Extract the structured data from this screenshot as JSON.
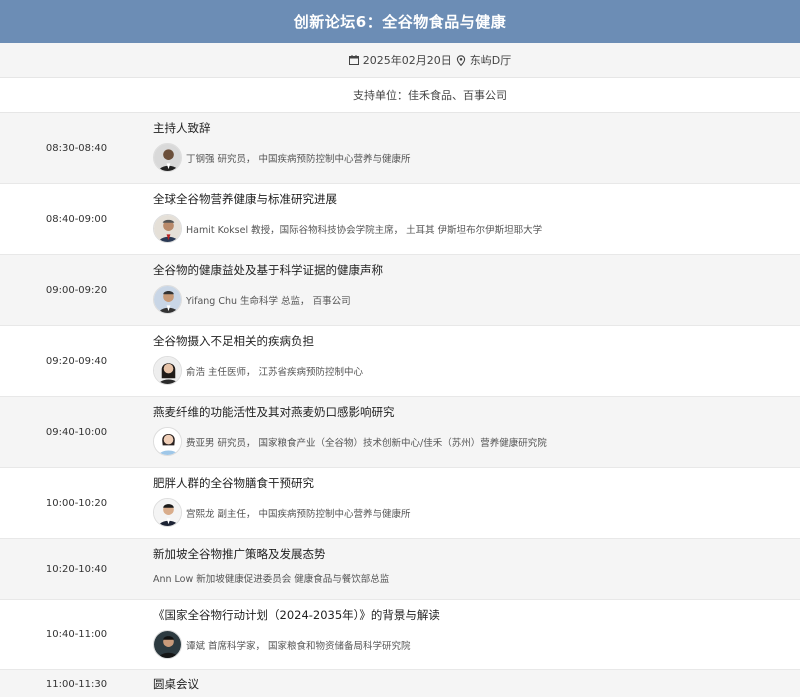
{
  "header": {
    "title": "创新论坛6：全谷物食品与健康"
  },
  "meta": {
    "date": "2025年02月20日",
    "location": "东屿D厅",
    "icons": {
      "date": "calendar-icon",
      "location": "location-pin-icon"
    }
  },
  "support": {
    "text": "支持单位：佳禾食品、百事公司"
  },
  "sessions": [
    {
      "time": "08:30-08:40",
      "title": "主持人致辞",
      "speaker": "丁钢强 研究员， 中国疾病预防控制中心营养与健康所"
    },
    {
      "time": "08:40-09:00",
      "title": "全球全谷物营养健康与标准研究进展",
      "speaker": "Hamit Koksel 教授，国际谷物科技协会学院主席， 土耳其 伊斯坦布尔伊斯坦耶大学"
    },
    {
      "time": "09:00-09:20",
      "title": "全谷物的健康益处及基于科学证据的健康声称",
      "speaker": "Yifang Chu 生命科学 总监， 百事公司"
    },
    {
      "time": "09:20-09:40",
      "title": "全谷物摄入不足相关的疾病负担",
      "speaker": "俞浩 主任医师， 江苏省疾病预防控制中心"
    },
    {
      "time": "09:40-10:00",
      "title": "燕麦纤维的功能活性及其对燕麦奶口感影响研究",
      "speaker": "费亚男 研究员， 国家粮食产业（全谷物）技术创新中心/佳禾（苏州）营养健康研究院"
    },
    {
      "time": "10:00-10:20",
      "title": "肥胖人群的全谷物膳食干预研究",
      "speaker": "宫熙龙 副主任， 中国疾病预防控制中心营养与健康所"
    },
    {
      "time": "10:20-10:40",
      "title": "新加坡全谷物推广策略及发展态势",
      "speaker": "Ann Low 新加坡健康促进委员会 健康食品与餐饮部总监"
    },
    {
      "time": "10:40-11:00",
      "title": "《国家全谷物行动计划（2024-2035年）》的背景与解读",
      "speaker": "谭斌 首席科学家， 国家粮食和物资储备局科学研究院"
    },
    {
      "time": "11:00-11:30",
      "title": "圆桌会议"
    }
  ]
}
